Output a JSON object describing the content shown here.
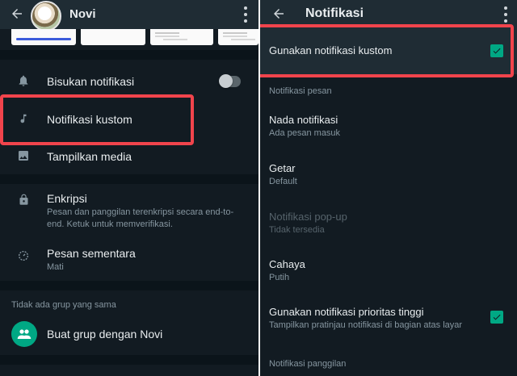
{
  "left": {
    "contact_name": "Novi",
    "rows": {
      "mute_label": "Bisukan notifikasi",
      "custom_label": "Notifikasi kustom",
      "media_label": "Tampilkan media",
      "encryption_label": "Enkripsi",
      "encryption_sub": "Pesan dan panggilan terenkripsi secara end-to-end. Ketuk untuk memverifikasi.",
      "ephemeral_label": "Pesan sementara",
      "ephemeral_sub": "Mati"
    },
    "groups_header": "Tidak ada grup yang sama",
    "create_group_label": "Buat grup dengan Novi",
    "mute_enabled": false
  },
  "right": {
    "title": "Notifikasi",
    "use_custom_label": "Gunakan notifikasi kustom",
    "use_custom_checked": true,
    "message_section": "Notifikasi pesan",
    "tone_label": "Nada notifikasi",
    "tone_value": "Ada pesan masuk",
    "vibrate_label": "Getar",
    "vibrate_value": "Default",
    "popup_label": "Notifikasi pop-up",
    "popup_value": "Tidak tersedia",
    "light_label": "Cahaya",
    "light_value": "Putih",
    "priority_label": "Gunakan notifikasi prioritas tinggi",
    "priority_sub": "Tampilkan pratinjau notifikasi di bagian atas layar",
    "priority_checked": true,
    "call_section": "Notifikasi panggilan"
  },
  "colors": {
    "accent": "#00a884",
    "highlight": "#f1444c",
    "background": "#121b22",
    "appbar": "#1f2c34"
  },
  "icons": {
    "back": "arrow-left-icon",
    "more": "more-vertical-icon",
    "mute": "bell-icon",
    "custom": "music-note-icon",
    "media": "image-icon",
    "encryption": "lock-icon",
    "ephemeral": "timer-icon",
    "group": "group-icon",
    "check": "check-icon"
  }
}
